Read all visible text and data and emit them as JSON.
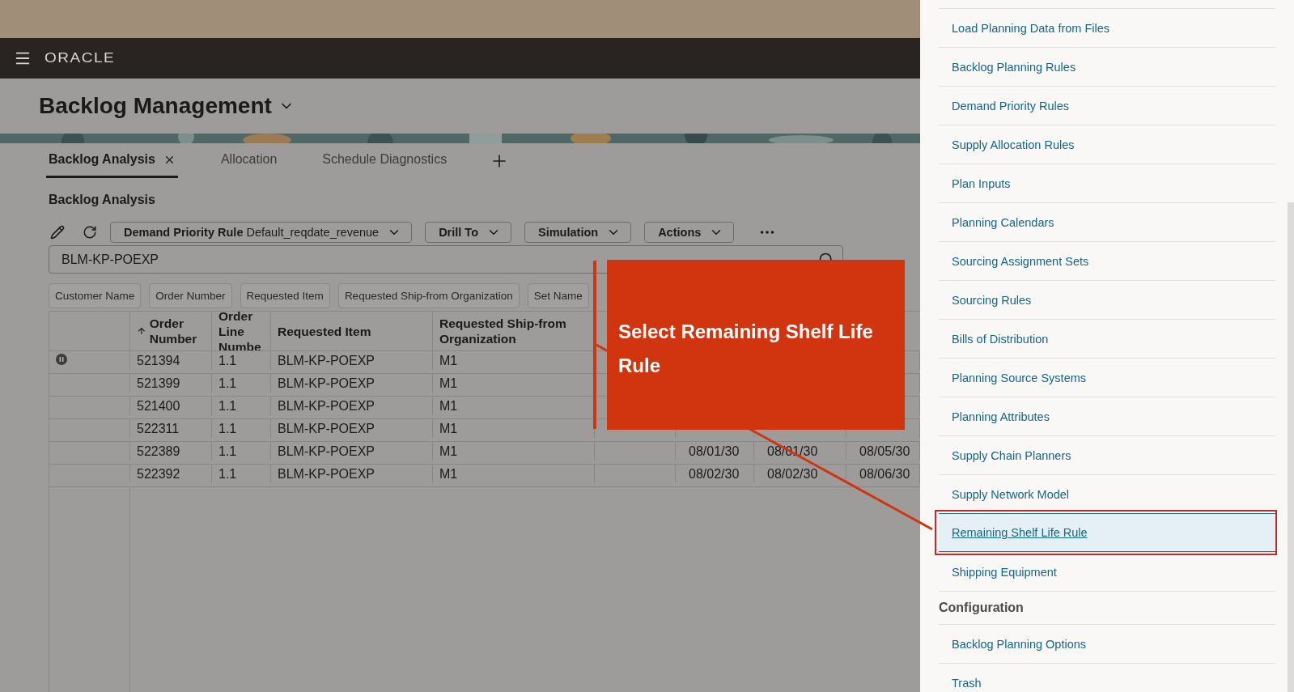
{
  "header": {
    "logo": "ORACLE"
  },
  "page": {
    "title": "Backlog Management"
  },
  "tabs": [
    {
      "label": "Backlog Analysis",
      "selected": true,
      "closable": true
    },
    {
      "label": "Allocation",
      "selected": false,
      "closable": false
    },
    {
      "label": "Schedule Diagnostics",
      "selected": false,
      "closable": false
    }
  ],
  "section_title": "Backlog Analysis",
  "toolbar": {
    "rule_select": {
      "label": "Demand Priority Rule",
      "value": "Default_reqdate_revenue"
    },
    "menus": [
      "Drill To",
      "Simulation",
      "Actions"
    ]
  },
  "search": {
    "value": "BLM-KP-POEXP"
  },
  "filter_chips": [
    "Customer Name",
    "Order Number",
    "Requested Item",
    "Requested Ship-from Organization",
    "Set Name"
  ],
  "table": {
    "columns": [
      {
        "label": "Order Number",
        "sorted": true
      },
      {
        "label": "Order Line Numbe",
        "sorted": false
      },
      {
        "label": "Requested Item",
        "sorted": false
      },
      {
        "label": "Requested Ship-from Organization",
        "sorted": false
      }
    ],
    "rows": [
      {
        "on_hold": true,
        "cells": [
          "521394",
          "1.1",
          "BLM-KP-POEXP",
          "M1"
        ]
      },
      {
        "on_hold": false,
        "cells": [
          "521399",
          "1.1",
          "BLM-KP-POEXP",
          "M1"
        ]
      },
      {
        "on_hold": false,
        "cells": [
          "521400",
          "1.1",
          "BLM-KP-POEXP",
          "M1"
        ]
      },
      {
        "on_hold": false,
        "cells": [
          "522311",
          "1.1",
          "BLM-KP-POEXP",
          "M1"
        ]
      },
      {
        "on_hold": false,
        "cells": [
          "522389",
          "1.1",
          "BLM-KP-POEXP",
          "M1"
        ],
        "dates": [
          "08/01/30",
          "08/01/30",
          "08/05/30"
        ]
      },
      {
        "on_hold": false,
        "cells": [
          "522392",
          "1.1",
          "BLM-KP-POEXP",
          "M1"
        ],
        "dates": [
          "08/02/30",
          "08/02/30",
          "08/06/30"
        ]
      }
    ]
  },
  "callout": {
    "text": "Select Remaining Shelf Life Rule"
  },
  "side_panel": {
    "groups": [
      {
        "items": [
          {
            "label": "Load Planning Data from Files",
            "selected": false
          },
          {
            "label": "Backlog Planning Rules",
            "selected": false
          },
          {
            "label": "Demand Priority Rules",
            "selected": false
          },
          {
            "label": "Supply Allocation Rules",
            "selected": false
          },
          {
            "label": "Plan Inputs",
            "selected": false
          },
          {
            "label": "Planning Calendars",
            "selected": false
          },
          {
            "label": "Sourcing Assignment Sets",
            "selected": false
          },
          {
            "label": "Sourcing Rules",
            "selected": false
          },
          {
            "label": "Bills of Distribution",
            "selected": false
          },
          {
            "label": "Planning Source Systems",
            "selected": false
          },
          {
            "label": "Planning Attributes",
            "selected": false
          },
          {
            "label": "Supply Chain Planners",
            "selected": false
          },
          {
            "label": "Supply Network Model",
            "selected": false
          },
          {
            "label": "Remaining Shelf Life Rule",
            "selected": true
          },
          {
            "label": "Shipping Equipment",
            "selected": false
          }
        ]
      },
      {
        "heading": "Configuration",
        "items": [
          {
            "label": "Backlog Planning Options",
            "selected": false
          },
          {
            "label": "Trash",
            "selected": false
          }
        ]
      }
    ]
  }
}
